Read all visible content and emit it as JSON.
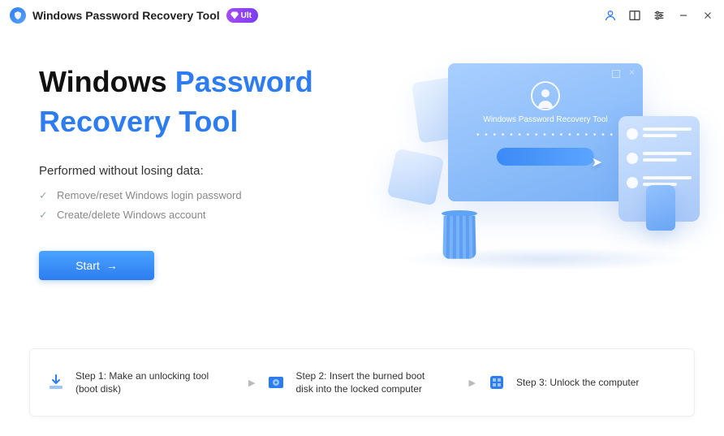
{
  "titlebar": {
    "app_title": "Windows Password Recovery Tool",
    "badge": "Ult"
  },
  "main": {
    "heading_part1": "Windows",
    "heading_part2": "Password",
    "heading_line2_pre": "Recovery Tool",
    "subtitle": "Performed without losing data:",
    "features": [
      "Remove/reset Windows login password",
      "Create/delete Windows account"
    ],
    "start_label": "Start"
  },
  "illustration": {
    "monitor_label": "Windows Password Recovery Tool",
    "dots": "• • • • • • • • • • • • • • • • •"
  },
  "steps": [
    {
      "label": "Step 1: Make an unlocking tool (boot disk)"
    },
    {
      "label": "Step 2: Insert the burned boot disk into the locked computer"
    },
    {
      "label": "Step 3: Unlock the computer"
    }
  ]
}
